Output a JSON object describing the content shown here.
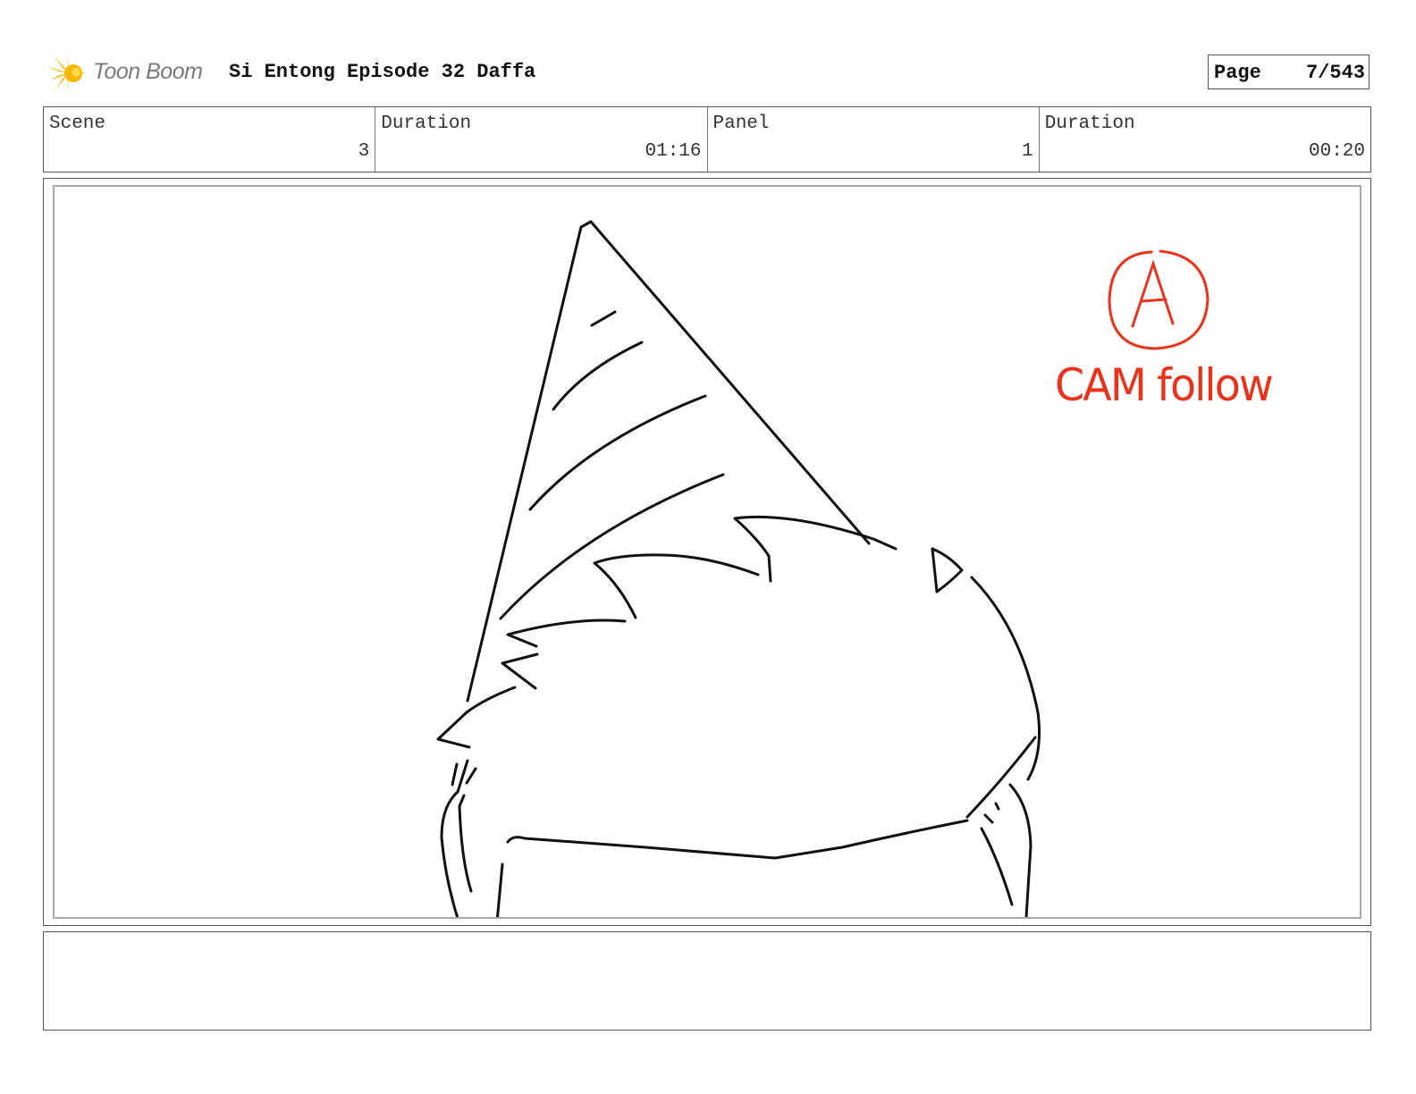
{
  "header": {
    "brand": "Toon Boom",
    "project_title": "Si Entong Episode 32 Daffa",
    "page_label": "Page",
    "page_value": "7/543"
  },
  "info": [
    {
      "label": "Scene",
      "value": "3"
    },
    {
      "label": "Duration",
      "value": "01:16"
    },
    {
      "label": "Panel",
      "value": "1"
    },
    {
      "label": "Duration",
      "value": "00:20"
    }
  ],
  "panel": {
    "annotation_letter": "A",
    "annotation_text": "CAM follow"
  },
  "notes": "",
  "colors": {
    "logo_yellow": "#f5c21b",
    "annotation_red": "#e8341c",
    "border": "#555555"
  }
}
